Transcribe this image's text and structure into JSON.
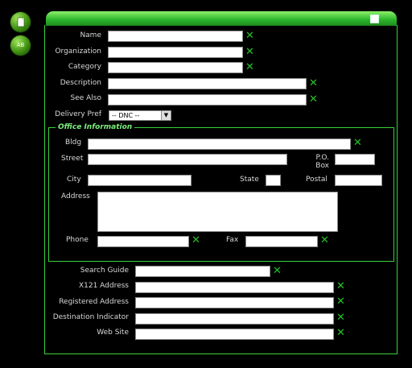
{
  "sidebar": {
    "top_button": "",
    "bottom_button": "AB"
  },
  "form": {
    "name_label": "Name",
    "organization_label": "Organization",
    "category_label": "Category",
    "description_label": "Description",
    "see_also_label": "See Also",
    "delivery_pref_label": "Delivery Pref",
    "delivery_pref_value": "-- DNC --",
    "office_legend": "Office Information",
    "bldg_label": "Bldg",
    "street_label": "Street",
    "po_box_label": "P.O.\nBox",
    "city_label": "City",
    "state_label": "State",
    "postal_label": "Postal",
    "address_label": "Address",
    "phone_label": "Phone",
    "fax_label": "Fax",
    "search_guide_label": "Search Guide",
    "x121_label": "X121 Address",
    "registered_address_label": "Registered Address",
    "destination_indicator_label": "Destination Indicator",
    "web_site_label": "Web Site"
  },
  "colors": {
    "accent": "#39d139",
    "title_bar": "#2bb32b",
    "background": "#000000"
  }
}
